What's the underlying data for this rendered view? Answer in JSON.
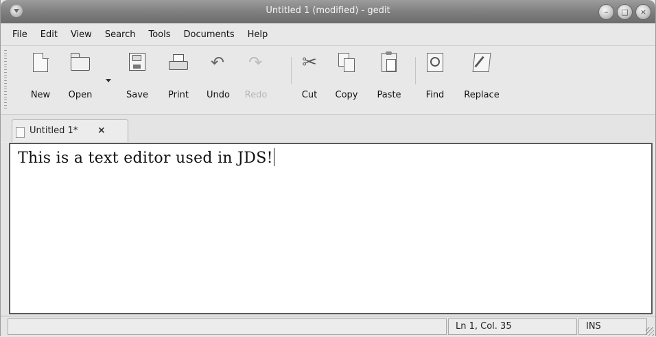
{
  "window": {
    "title": "Untitled 1 (modified) - gedit",
    "controls": [
      "minimize-icon",
      "maximize-icon",
      "close-icon"
    ]
  },
  "menu": {
    "items": [
      {
        "label": "File"
      },
      {
        "label": "Edit"
      },
      {
        "label": "View"
      },
      {
        "label": "Search"
      },
      {
        "label": "Tools"
      },
      {
        "label": "Documents"
      },
      {
        "label": "Help"
      }
    ]
  },
  "toolbar": {
    "new": "New",
    "open": "Open",
    "save": "Save",
    "print": "Print",
    "undo": "Undo",
    "redo": "Redo",
    "cut": "Cut",
    "copy": "Copy",
    "paste": "Paste",
    "find": "Find",
    "replace": "Replace"
  },
  "tabs": [
    {
      "label": "Untitled 1*",
      "close": "×"
    }
  ],
  "editor": {
    "content": "This is a text editor used in JDS!"
  },
  "statusbar": {
    "message": "",
    "position": "Ln 1, Col. 35",
    "mode": "INS"
  }
}
